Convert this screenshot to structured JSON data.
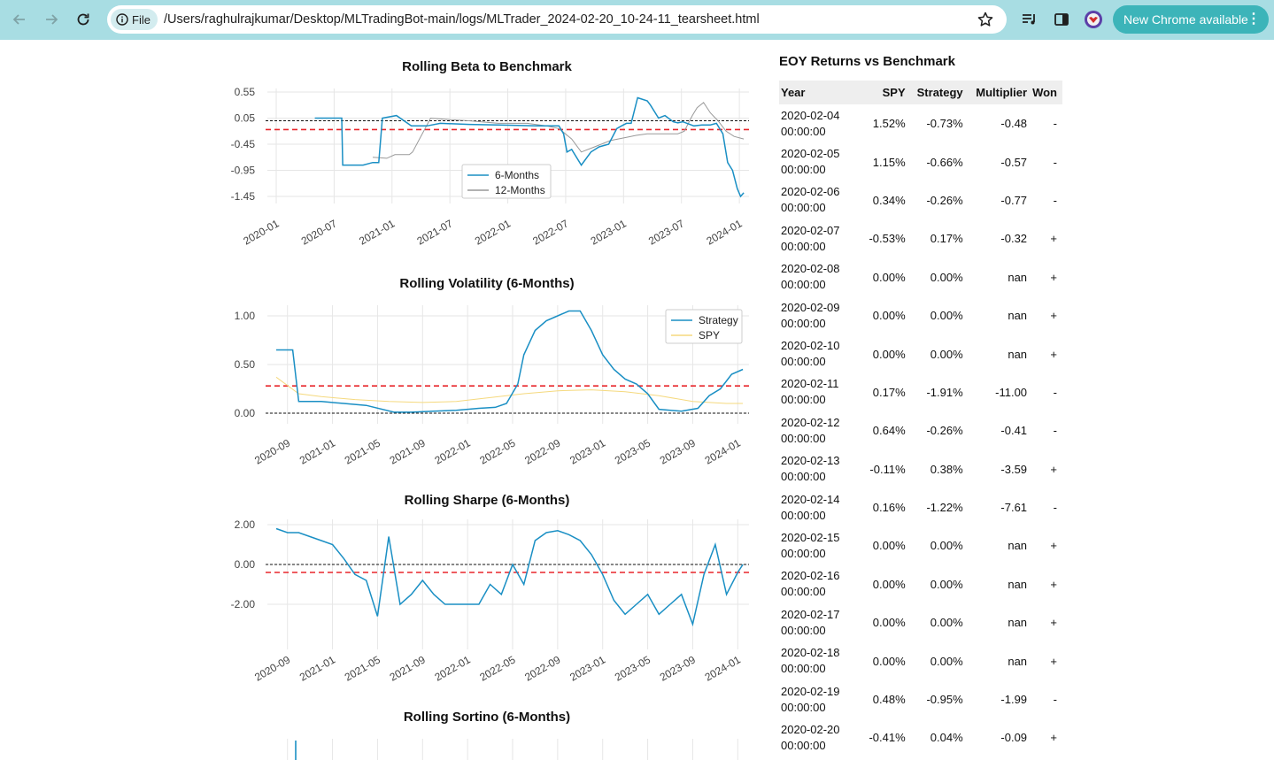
{
  "browser": {
    "file_chip": "File",
    "url": "/Users/raghulrajkumar/Desktop/MLTradingBot-main/logs/MLTrader_2024-02-20_10-24-11_tearsheet.html",
    "update_button": "New Chrome available",
    "icons": [
      "back-arrow-icon",
      "forward-arrow-icon",
      "reload-icon",
      "info-icon",
      "star-icon",
      "media-control-icon",
      "side-panel-icon",
      "profile-avatar-icon",
      "kebab-menu-icon"
    ]
  },
  "colors": {
    "strategy": "#1a8fc4",
    "benchmark_12m": "#999999",
    "spy": "#f5d97e",
    "mean_line": "#e8262b",
    "zero_line": "#111111",
    "chrome_bg": "#a8dde3",
    "update_btn": "#3cb4b9"
  },
  "chart_data": [
    {
      "type": "line",
      "title": "Rolling Beta to Benchmark",
      "x_ticks": [
        "2020-01",
        "2020-07",
        "2021-01",
        "2021-07",
        "2022-01",
        "2022-07",
        "2023-01",
        "2023-07",
        "2024-01"
      ],
      "y_ticks": [
        "0.55",
        "0.05",
        "-0.45",
        "-0.95",
        "-1.45"
      ],
      "ylim": [
        -1.45,
        0.55
      ],
      "legend": "lower-center",
      "grid": true,
      "reference_lines": {
        "zero": 0.0,
        "mean": -0.17
      },
      "series": [
        {
          "name": "6-Months",
          "x": [
            "2020-05-01",
            "2020-06-15",
            "2020-06-20",
            "2020-07-25",
            "2020-07-28",
            "2020-08-10",
            "2020-09-10",
            "2020-10-01",
            "2020-11-01",
            "2020-11-20",
            "2020-12-01",
            "2021-01-15",
            "2021-03-01",
            "2021-04-20",
            "2021-06-01",
            "2021-09-01",
            "2021-12-01",
            "2022-02-01",
            "2022-04-01",
            "2022-05-20",
            "2022-06-10",
            "2022-06-25",
            "2022-07-05",
            "2022-07-20",
            "2022-08-20",
            "2022-09-20",
            "2022-10-15",
            "2022-11-15",
            "2022-12-10",
            "2022-12-25",
            "2023-01-10",
            "2023-01-25",
            "2023-02-15",
            "2023-03-15",
            "2023-03-25",
            "2023-04-20",
            "2023-05-10",
            "2023-06-05",
            "2023-06-20",
            "2023-07-05",
            "2023-08-10",
            "2023-09-05",
            "2023-10-01",
            "2023-10-20",
            "2023-11-10",
            "2023-11-25",
            "2023-12-10",
            "2023-12-25",
            "2024-01-05",
            "2024-01-15"
          ],
          "values": [
            0.05,
            0.05,
            0.05,
            0.05,
            -0.85,
            -0.85,
            -0.85,
            -0.85,
            -0.8,
            -0.8,
            0.05,
            0.1,
            -0.1,
            -0.1,
            -0.05,
            -0.07,
            -0.08,
            -0.09,
            -0.1,
            -0.1,
            -0.1,
            -0.25,
            -0.6,
            -0.55,
            -0.85,
            -0.6,
            -0.5,
            -0.45,
            -0.15,
            -0.1,
            -0.05,
            -0.05,
            0.44,
            0.38,
            0.3,
            0.05,
            0.1,
            -0.02,
            -0.04,
            -0.02,
            -0.1,
            -0.08,
            -0.08,
            -0.05,
            -0.25,
            -0.8,
            -0.95,
            -1.3,
            -1.45,
            -1.38
          ]
        },
        {
          "name": "12-Months",
          "x": [
            "2020-11-01",
            "2020-12-15",
            "2021-01-10",
            "2021-02-01",
            "2021-02-25",
            "2021-03-05",
            "2021-05-01",
            "2021-07-01",
            "2021-09-01",
            "2021-12-01",
            "2022-03-01",
            "2022-05-01",
            "2022-06-10",
            "2022-07-20",
            "2022-08-20",
            "2022-10-01",
            "2022-11-20",
            "2023-01-10",
            "2023-02-10",
            "2023-03-15",
            "2023-04-20",
            "2023-05-20",
            "2023-06-20",
            "2023-07-10",
            "2023-08-05",
            "2023-08-20",
            "2023-09-10",
            "2023-10-01",
            "2023-10-25",
            "2023-11-20",
            "2023-12-15",
            "2024-01-15"
          ],
          "values": [
            -0.7,
            -0.72,
            -0.65,
            -0.65,
            -0.65,
            -0.6,
            0.05,
            0.02,
            0.0,
            -0.05,
            -0.05,
            -0.1,
            -0.15,
            -0.35,
            -0.6,
            -0.5,
            -0.38,
            -0.32,
            -0.28,
            -0.25,
            -0.25,
            -0.25,
            -0.25,
            -0.2,
            0.1,
            0.25,
            0.35,
            0.15,
            0.0,
            -0.2,
            -0.3,
            -0.35
          ]
        }
      ]
    },
    {
      "type": "line",
      "title": "Rolling Volatility (6-Months)",
      "x_ticks": [
        "2020-09",
        "2021-01",
        "2021-05",
        "2021-09",
        "2022-01",
        "2022-05",
        "2022-09",
        "2023-01",
        "2023-05",
        "2023-09",
        "2024-01"
      ],
      "y_ticks": [
        "1.00",
        "0.50",
        "0.00"
      ],
      "ylim": [
        0.0,
        1.1
      ],
      "legend": "top-right",
      "grid": true,
      "reference_lines": {
        "zero": 0.0,
        "mean": 0.28
      },
      "series": [
        {
          "name": "Strategy",
          "x": [
            "2020-08-01",
            "2020-09-15",
            "2020-10-01",
            "2020-11-01",
            "2020-12-01",
            "2021-02-01",
            "2021-04-01",
            "2021-06-15",
            "2021-08-01",
            "2021-10-01",
            "2021-12-01",
            "2022-02-01",
            "2022-03-15",
            "2022-04-15",
            "2022-05-15",
            "2022-06-01",
            "2022-07-01",
            "2022-08-01",
            "2022-09-01",
            "2022-10-01",
            "2022-11-01",
            "2022-12-01",
            "2023-01-01",
            "2023-02-01",
            "2023-03-01",
            "2023-04-01",
            "2023-05-01",
            "2023-06-01",
            "2023-08-01",
            "2023-09-15",
            "2023-10-15",
            "2023-11-15",
            "2023-12-15",
            "2024-01-15"
          ],
          "values": [
            0.65,
            0.65,
            0.12,
            0.12,
            0.12,
            0.1,
            0.08,
            0.01,
            0.01,
            0.02,
            0.03,
            0.05,
            0.06,
            0.1,
            0.3,
            0.6,
            0.85,
            0.95,
            1.0,
            1.05,
            1.05,
            0.85,
            0.6,
            0.45,
            0.35,
            0.3,
            0.2,
            0.04,
            0.02,
            0.05,
            0.18,
            0.25,
            0.4,
            0.45
          ]
        },
        {
          "name": "SPY",
          "x": [
            "2020-08-01",
            "2020-10-01",
            "2020-12-01",
            "2021-03-01",
            "2021-06-01",
            "2021-09-01",
            "2021-12-01",
            "2022-03-01",
            "2022-06-01",
            "2022-09-01",
            "2022-12-01",
            "2023-03-01",
            "2023-06-01",
            "2023-09-01",
            "2023-12-01",
            "2024-01-15"
          ],
          "values": [
            0.37,
            0.2,
            0.17,
            0.14,
            0.12,
            0.11,
            0.12,
            0.16,
            0.2,
            0.23,
            0.24,
            0.22,
            0.18,
            0.12,
            0.1,
            0.1
          ]
        }
      ]
    },
    {
      "type": "line",
      "title": "Rolling Sharpe (6-Months)",
      "x_ticks": [
        "2020-09",
        "2021-01",
        "2021-05",
        "2021-09",
        "2022-01",
        "2022-05",
        "2022-09",
        "2023-01",
        "2023-05",
        "2023-09",
        "2024-01"
      ],
      "y_ticks": [
        "2.00",
        "0.00",
        "-2.00"
      ],
      "ylim": [
        -3.2,
        2.2
      ],
      "grid": true,
      "reference_lines": {
        "zero": 0.0,
        "mean": -0.4
      },
      "series": [
        {
          "name": "Strategy",
          "x": [
            "2020-08-01",
            "2020-09-01",
            "2020-10-01",
            "2020-11-01",
            "2020-12-01",
            "2021-01-01",
            "2021-02-01",
            "2021-03-01",
            "2021-04-01",
            "2021-05-01",
            "2021-06-01",
            "2021-07-01",
            "2021-08-01",
            "2021-09-01",
            "2021-10-01",
            "2021-11-01",
            "2021-12-01",
            "2022-01-01",
            "2022-02-01",
            "2022-03-01",
            "2022-04-01",
            "2022-05-01",
            "2022-06-01",
            "2022-07-01",
            "2022-08-01",
            "2022-09-01",
            "2022-10-01",
            "2022-11-01",
            "2022-12-01",
            "2023-01-01",
            "2023-02-01",
            "2023-03-01",
            "2023-04-01",
            "2023-05-01",
            "2023-06-01",
            "2023-07-01",
            "2023-08-01",
            "2023-09-01",
            "2023-10-01",
            "2023-11-01",
            "2023-12-01",
            "2024-01-01",
            "2024-01-15"
          ],
          "values": [
            1.8,
            1.6,
            1.6,
            1.4,
            1.2,
            1.0,
            0.3,
            -0.5,
            -0.8,
            -2.6,
            1.4,
            -2.0,
            -1.5,
            -0.8,
            -1.5,
            -2.0,
            -2.0,
            -2.0,
            -2.0,
            -1.0,
            -1.5,
            0.0,
            -1.0,
            1.2,
            1.6,
            1.7,
            1.5,
            1.2,
            0.5,
            -0.5,
            -1.8,
            -2.5,
            -2.0,
            -1.5,
            -2.5,
            -2.0,
            -1.5,
            -3.0,
            -0.5,
            1.0,
            -1.5,
            -0.4,
            0.0
          ]
        }
      ]
    },
    {
      "type": "line",
      "title": "Rolling Sortino (6-Months)",
      "series": []
    }
  ],
  "eoy_table": {
    "title": "EOY Returns vs Benchmark",
    "columns": [
      "Year",
      "SPY",
      "Strategy",
      "Multiplier",
      "Won"
    ],
    "rows": [
      {
        "date": "2020-02-04",
        "time": "00:00:00",
        "spy": "1.52%",
        "strategy": "-0.73%",
        "multiplier": "-0.48",
        "won": "-"
      },
      {
        "date": "2020-02-05",
        "time": "00:00:00",
        "spy": "1.15%",
        "strategy": "-0.66%",
        "multiplier": "-0.57",
        "won": "-"
      },
      {
        "date": "2020-02-06",
        "time": "00:00:00",
        "spy": "0.34%",
        "strategy": "-0.26%",
        "multiplier": "-0.77",
        "won": "-"
      },
      {
        "date": "2020-02-07",
        "time": "00:00:00",
        "spy": "-0.53%",
        "strategy": "0.17%",
        "multiplier": "-0.32",
        "won": "+"
      },
      {
        "date": "2020-02-08",
        "time": "00:00:00",
        "spy": "0.00%",
        "strategy": "0.00%",
        "multiplier": "nan",
        "won": "+"
      },
      {
        "date": "2020-02-09",
        "time": "00:00:00",
        "spy": "0.00%",
        "strategy": "0.00%",
        "multiplier": "nan",
        "won": "+"
      },
      {
        "date": "2020-02-10",
        "time": "00:00:00",
        "spy": "0.00%",
        "strategy": "0.00%",
        "multiplier": "nan",
        "won": "+"
      },
      {
        "date": "2020-02-11",
        "time": "00:00:00",
        "spy": "0.17%",
        "strategy": "-1.91%",
        "multiplier": "-11.00",
        "won": "-"
      },
      {
        "date": "2020-02-12",
        "time": "00:00:00",
        "spy": "0.64%",
        "strategy": "-0.26%",
        "multiplier": "-0.41",
        "won": "-"
      },
      {
        "date": "2020-02-13",
        "time": "00:00:00",
        "spy": "-0.11%",
        "strategy": "0.38%",
        "multiplier": "-3.59",
        "won": "+"
      },
      {
        "date": "2020-02-14",
        "time": "00:00:00",
        "spy": "0.16%",
        "strategy": "-1.22%",
        "multiplier": "-7.61",
        "won": "-"
      },
      {
        "date": "2020-02-15",
        "time": "00:00:00",
        "spy": "0.00%",
        "strategy": "0.00%",
        "multiplier": "nan",
        "won": "+"
      },
      {
        "date": "2020-02-16",
        "time": "00:00:00",
        "spy": "0.00%",
        "strategy": "0.00%",
        "multiplier": "nan",
        "won": "+"
      },
      {
        "date": "2020-02-17",
        "time": "00:00:00",
        "spy": "0.00%",
        "strategy": "0.00%",
        "multiplier": "nan",
        "won": "+"
      },
      {
        "date": "2020-02-18",
        "time": "00:00:00",
        "spy": "0.00%",
        "strategy": "0.00%",
        "multiplier": "nan",
        "won": "+"
      },
      {
        "date": "2020-02-19",
        "time": "00:00:00",
        "spy": "0.48%",
        "strategy": "-0.95%",
        "multiplier": "-1.99",
        "won": "-"
      },
      {
        "date": "2020-02-20",
        "time": "00:00:00",
        "spy": "-0.41%",
        "strategy": "0.04%",
        "multiplier": "-0.09",
        "won": "+"
      }
    ]
  }
}
